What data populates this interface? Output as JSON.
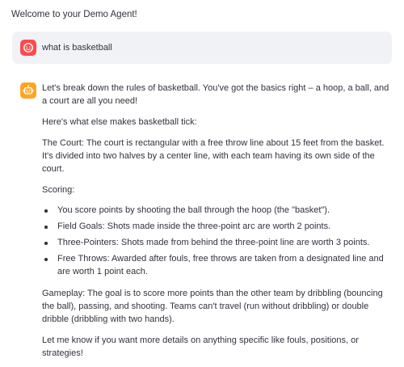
{
  "page": {
    "title": "Welcome to your Demo Agent!"
  },
  "colors": {
    "user_avatar": "#ff4b4b",
    "assistant_avatar": "#ffa421",
    "user_bubble": "#f0f2f6",
    "text": "#31333f"
  },
  "icons": {
    "user_avatar": "smiley-face-icon",
    "assistant_avatar": "robot-icon"
  },
  "user_message": {
    "text": "what is basketball"
  },
  "assistant_message": {
    "intro": "Let's break down the rules of basketball. You've got the basics right – a hoop, a ball, and a court are all you need!",
    "tick": "Here's what else makes basketball tick:",
    "court": "The Court: The court is rectangular with a free throw line about 15 feet from the basket. It's divided into two halves by a center line, with each team having its own side of the court.",
    "scoring_heading": "Scoring:",
    "scoring_items": [
      "You score points by shooting the ball through the hoop (the \"basket\").",
      "Field Goals: Shots made inside the three-point arc are worth 2 points.",
      "Three-Pointers: Shots made from behind the three-point line are worth 3 points.",
      "Free Throws: Awarded after fouls, free throws are taken from a designated line and are worth 1 point each."
    ],
    "gameplay": "Gameplay: The goal is to score more points than the other team by dribbling (bouncing the ball), passing, and shooting. Teams can't travel (run without dribbling) or double dribble (dribbling with two hands).",
    "closing": "Let me know if you want more details on anything specific like fouls, positions, or strategies!"
  }
}
